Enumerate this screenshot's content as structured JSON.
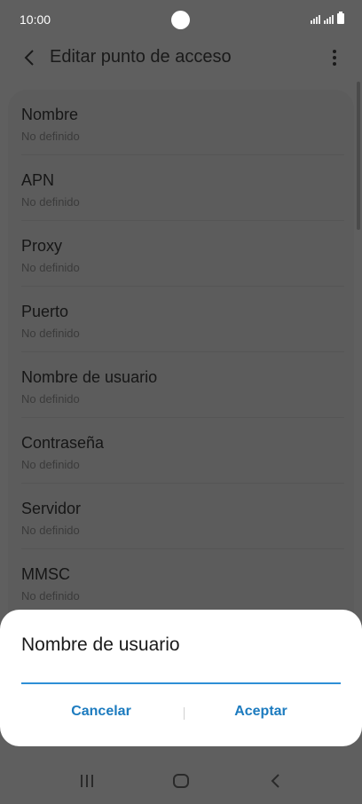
{
  "status_bar": {
    "time": "10:00"
  },
  "header": {
    "title": "Editar punto de acceso",
    "back_icon": "chevron-left-icon",
    "menu_icon": "more-vertical-icon"
  },
  "settings": {
    "items": [
      {
        "title": "Nombre",
        "value": "No definido"
      },
      {
        "title": "APN",
        "value": "No definido"
      },
      {
        "title": "Proxy",
        "value": "No definido"
      },
      {
        "title": "Puerto",
        "value": "No definido"
      },
      {
        "title": "Nombre de usuario",
        "value": "No definido"
      },
      {
        "title": "Contraseña",
        "value": "No definido"
      },
      {
        "title": "Servidor",
        "value": "No definido"
      },
      {
        "title": "MMSC",
        "value": "No definido"
      }
    ]
  },
  "dialog": {
    "title": "Nombre de usuario",
    "input_value": "",
    "cancel_label": "Cancelar",
    "accept_label": "Aceptar",
    "accent_color": "#1c7bbf"
  },
  "nav_bar": {
    "recents_icon": "recents-icon",
    "home_icon": "home-icon",
    "back_icon": "back-icon"
  }
}
